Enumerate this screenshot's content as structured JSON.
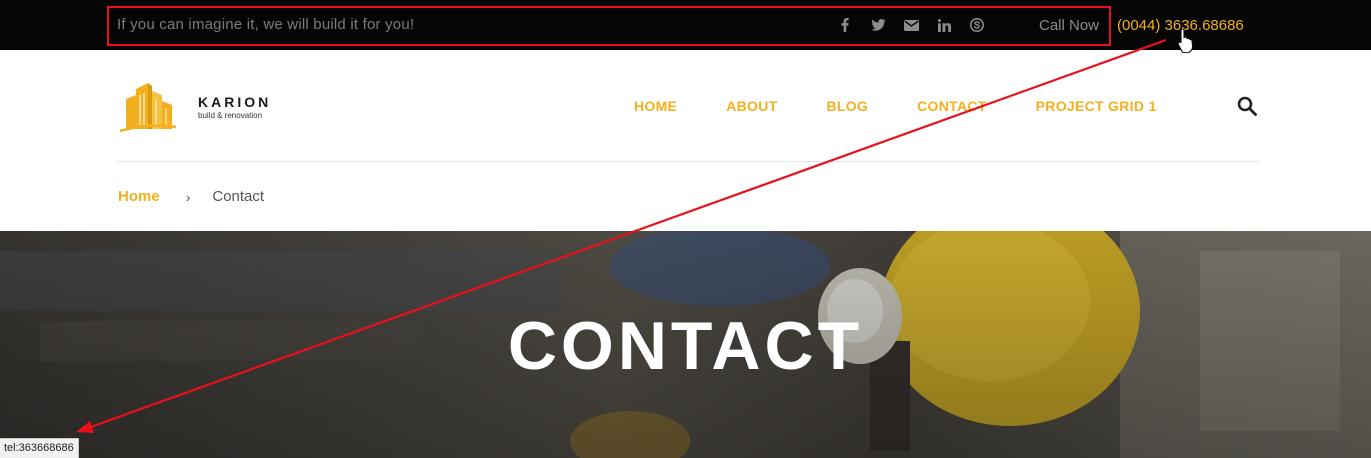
{
  "topbar": {
    "tagline": "If you can imagine it, we will build it for you!",
    "socials": [
      {
        "icon": "facebook-icon"
      },
      {
        "icon": "twitter-icon"
      },
      {
        "icon": "envelope-icon"
      },
      {
        "icon": "linkedin-icon"
      },
      {
        "icon": "skype-icon"
      }
    ],
    "call_label": "Call Now",
    "phone": "(0044) 3636.68686"
  },
  "brand": {
    "name": "KARION",
    "tagline": "build & renovation"
  },
  "nav": {
    "items": [
      {
        "label": "HOME"
      },
      {
        "label": "ABOUT"
      },
      {
        "label": "BLOG"
      },
      {
        "label": "CONTACT"
      },
      {
        "label": "PROJECT GRID 1"
      }
    ],
    "search_icon": "search-icon"
  },
  "breadcrumb": {
    "home": "Home",
    "separator": "›",
    "current": "Contact"
  },
  "hero": {
    "title": "CONTACT"
  },
  "status_bar": {
    "link_preview": "tel:363668686"
  },
  "colors": {
    "accent": "#f2b01e",
    "topbar_bg": "#050505",
    "annotation": "#e8101a"
  }
}
